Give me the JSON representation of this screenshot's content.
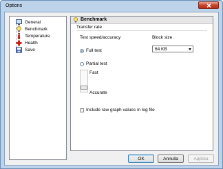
{
  "window": {
    "title": "Options",
    "close_icon": "close-icon"
  },
  "tree": {
    "items": [
      {
        "label": "General",
        "icon": "monitor-icon"
      },
      {
        "label": "Benchmark",
        "icon": "lightbulb-icon"
      },
      {
        "label": "Temperature",
        "icon": "thermometer-icon"
      },
      {
        "label": "Health",
        "icon": "red-cross-icon"
      },
      {
        "label": "Save",
        "icon": "floppy-disk-icon"
      }
    ]
  },
  "panel": {
    "title": "Benchmark",
    "icon": "lightbulb-icon",
    "section": "Transfer rate",
    "speed_label": "Test speed/accuracy",
    "full_test": "Full test",
    "partial_test": "Partial test",
    "slider_top": "Fast",
    "slider_bottom": "Accurate",
    "block_size_label": "Block size",
    "block_size_value": "64 KB",
    "raw_values_label": "Include raw graph values in log file"
  },
  "buttons": {
    "ok": "OK",
    "cancel": "Annulla",
    "apply": "Applica"
  }
}
